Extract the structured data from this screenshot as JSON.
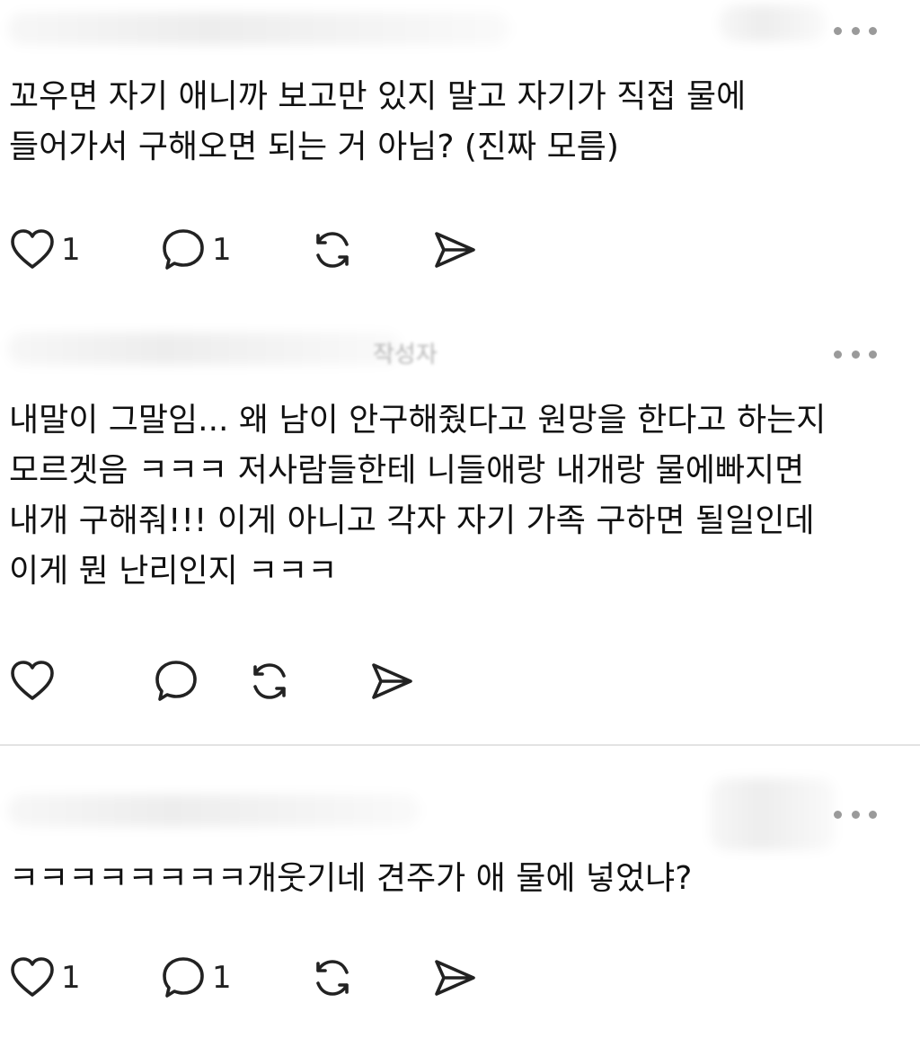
{
  "posts": [
    {
      "text": "꼬우면 자기 애니까 보고만 있지 말고 자기가 직접 물에\n들어가서 구해오면 되는 거 아님? (진짜 모름)",
      "likes": "1",
      "replies": "1"
    },
    {
      "author_fragment": "작성자",
      "text": "내말이 그말임... 왜 남이 안구해줬다고 원망을 한다고 하는지\n모르겟음 ㅋㅋㅋ 저사람들한테 니들애랑 내개랑 물에빠지면\n내개 구해줘!!! 이게 아니고 각자 자기 가족 구하면 될일인데\n이게 뭔 난리인지 ㅋㅋㅋ",
      "likes": "",
      "replies": ""
    },
    {
      "text": "ㅋㅋㅋㅋㅋㅋㅋㅋ개웃기네 견주가 애 물에 넣었냐?",
      "likes": "1",
      "replies": "1"
    }
  ],
  "icons": {
    "like": "heart-icon",
    "reply": "comment-icon",
    "repost": "repost-icon",
    "share": "send-icon",
    "more": "more-icon"
  },
  "colors": {
    "text": "#111111",
    "icon": "#222222",
    "more_dots": "#9a9a9a",
    "divider": "#e3e3e3"
  }
}
